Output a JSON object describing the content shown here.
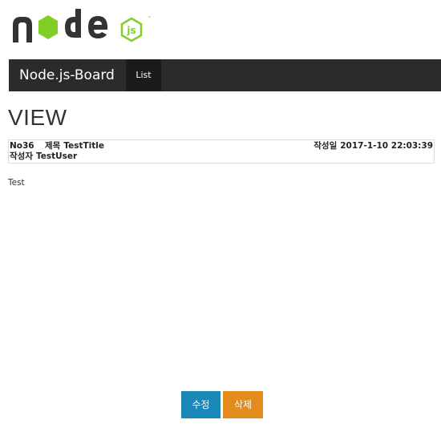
{
  "logo": {
    "text": "node",
    "badge": "js",
    "accent": "#83cd29",
    "dark": "#333333"
  },
  "navbar": {
    "brand": "Node.js-Board",
    "list_label": "List",
    "background": "#2b2b2b"
  },
  "page": {
    "heading": "VIEW"
  },
  "post": {
    "number": "No36",
    "title_label": "제목",
    "title": "TestTitle",
    "date_label": "작성일",
    "date": "2017-1-10 22:03:39",
    "author_label": "작성자",
    "author": "TestUser",
    "content": "Test"
  },
  "buttons": {
    "edit_label": "수정",
    "delete_label": "삭제",
    "edit_color": "#1a87b6",
    "delete_color": "#e38b1b"
  }
}
